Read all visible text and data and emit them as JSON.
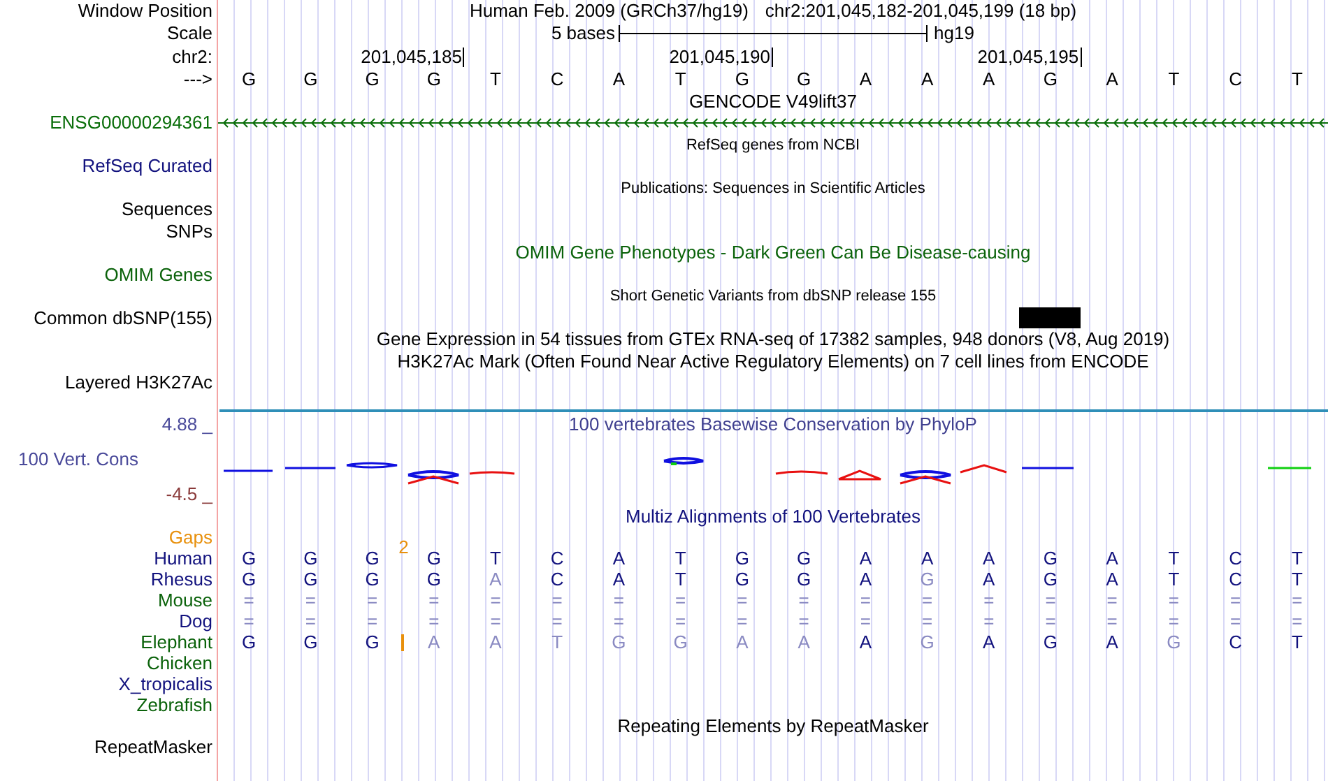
{
  "header": {
    "window_label": "Window Position",
    "assembly": "Human Feb. 2009 (GRCh37/hg19)",
    "position": "chr2:201,045,182-201,045,199 (18 bp)",
    "scale_label": "Scale",
    "scale_text": "5 bases",
    "scale_db": "hg19",
    "chrom_label": "chr2:",
    "ticks": [
      "201,045,185",
      "201,045,190",
      "201,045,195"
    ],
    "strand_label": "--->",
    "bases": [
      "G",
      "G",
      "G",
      "G",
      "T",
      "C",
      "A",
      "T",
      "G",
      "G",
      "A",
      "A",
      "A",
      "G",
      "A",
      "T",
      "C",
      "T"
    ]
  },
  "tracks": [
    {
      "kind": "title",
      "text": "GENCODE V49lift37",
      "color": "#000000"
    },
    {
      "kind": "gene",
      "label": "ENSG00000294361",
      "color": "#0a6e0a"
    },
    {
      "kind": "small_title",
      "text": "RefSeq genes from NCBI",
      "color": "#000000"
    },
    {
      "kind": "label",
      "label": "RefSeq Curated",
      "color": "#12127e"
    },
    {
      "kind": "small_title",
      "text": "Publications: Sequences in Scientific Articles",
      "color": "#000000"
    },
    {
      "kind": "label",
      "label": "Sequences",
      "color": "#000000"
    },
    {
      "kind": "label",
      "label": "SNPs",
      "color": "#000000"
    },
    {
      "kind": "title",
      "text": "OMIM Gene Phenotypes - Dark Green Can Be Disease-causing",
      "color": "#0a620a"
    },
    {
      "kind": "label",
      "label": "OMIM Genes",
      "color": "#0a620a"
    },
    {
      "kind": "small_title",
      "text": "Short Genetic Variants from dbSNP release 155",
      "color": "#000000"
    },
    {
      "kind": "snp",
      "label": "Common dbSNP(155)",
      "color": "#000000"
    },
    {
      "kind": "title",
      "text": "Gene Expression in 54 tissues from GTEx RNA-seq of 17382 samples, 948 donors (V8, Aug 2019)",
      "color": "#000000"
    },
    {
      "kind": "title",
      "text": "H3K27Ac Mark (Often Found Near Active Regulatory Elements) on 7 cell lines from ENCODE",
      "color": "#000000"
    },
    {
      "kind": "label",
      "label": "Layered H3K27Ac",
      "color": "#000000"
    }
  ],
  "conservation": {
    "title": "100 vertebrates Basewise Conservation by PhyloP",
    "label": "100 Vert. Cons",
    "max": "4.88 _",
    "min": "-4.5 _"
  },
  "alignment": {
    "title": "Multiz Alignments of 100 Vertebrates",
    "gaps_label": "Gaps",
    "species": [
      {
        "name": "Human",
        "color": "#12127e",
        "bases": [
          {
            "base": "G",
            "match": true
          },
          {
            "base": "G",
            "match": true
          },
          {
            "base": "G",
            "match": true
          },
          {
            "base": "G",
            "match": true
          },
          {
            "base": "T",
            "match": true
          },
          {
            "base": "C",
            "match": true
          },
          {
            "base": "A",
            "match": true
          },
          {
            "base": "T",
            "match": true
          },
          {
            "base": "G",
            "match": true
          },
          {
            "base": "G",
            "match": true
          },
          {
            "base": "A",
            "match": true
          },
          {
            "base": "A",
            "match": true
          },
          {
            "base": "A",
            "match": true
          },
          {
            "base": "G",
            "match": true
          },
          {
            "base": "A",
            "match": true
          },
          {
            "base": "T",
            "match": true
          },
          {
            "base": "C",
            "match": true
          },
          {
            "base": "T",
            "match": true
          }
        ]
      },
      {
        "name": "Rhesus",
        "color": "#12127e",
        "bases": [
          {
            "base": "G",
            "match": true
          },
          {
            "base": "G",
            "match": true
          },
          {
            "base": "G",
            "match": true
          },
          {
            "base": "G",
            "match": true
          },
          {
            "base": "A",
            "match": false
          },
          {
            "base": "C",
            "match": true
          },
          {
            "base": "A",
            "match": true
          },
          {
            "base": "T",
            "match": true
          },
          {
            "base": "G",
            "match": true
          },
          {
            "base": "G",
            "match": true
          },
          {
            "base": "A",
            "match": true
          },
          {
            "base": "G",
            "match": false
          },
          {
            "base": "A",
            "match": true
          },
          {
            "base": "G",
            "match": true
          },
          {
            "base": "A",
            "match": true
          },
          {
            "base": "T",
            "match": true
          },
          {
            "base": "C",
            "match": true
          },
          {
            "base": "T",
            "match": true
          }
        ]
      },
      {
        "name": "Mouse",
        "color": "#0a620a",
        "bases": [
          {
            "base": "=",
            "match": false
          },
          {
            "base": "=",
            "match": false
          },
          {
            "base": "=",
            "match": false
          },
          {
            "base": "=",
            "match": false
          },
          {
            "base": "=",
            "match": false
          },
          {
            "base": "=",
            "match": false
          },
          {
            "base": "=",
            "match": false
          },
          {
            "base": "=",
            "match": false
          },
          {
            "base": "=",
            "match": false
          },
          {
            "base": "=",
            "match": false
          },
          {
            "base": "=",
            "match": false
          },
          {
            "base": "=",
            "match": false
          },
          {
            "base": "=",
            "match": false
          },
          {
            "base": "=",
            "match": false
          },
          {
            "base": "=",
            "match": false
          },
          {
            "base": "=",
            "match": false
          },
          {
            "base": "=",
            "match": false
          },
          {
            "base": "=",
            "match": false
          }
        ]
      },
      {
        "name": "Dog",
        "color": "#12127e",
        "bases": [
          {
            "base": "=",
            "match": false
          },
          {
            "base": "=",
            "match": false
          },
          {
            "base": "=",
            "match": false
          },
          {
            "base": "=",
            "match": false
          },
          {
            "base": "=",
            "match": false
          },
          {
            "base": "=",
            "match": false
          },
          {
            "base": "=",
            "match": false
          },
          {
            "base": "=",
            "match": false
          },
          {
            "base": "=",
            "match": false
          },
          {
            "base": "=",
            "match": false
          },
          {
            "base": "=",
            "match": false
          },
          {
            "base": "=",
            "match": false
          },
          {
            "base": "=",
            "match": false
          },
          {
            "base": "=",
            "match": false
          },
          {
            "base": "=",
            "match": false
          },
          {
            "base": "=",
            "match": false
          },
          {
            "base": "=",
            "match": false
          },
          {
            "base": "=",
            "match": false
          }
        ]
      },
      {
        "name": "Elephant",
        "color": "#0a620a",
        "bases": [
          {
            "base": "G",
            "match": true
          },
          {
            "base": "G",
            "match": true
          },
          {
            "base": "G",
            "match": true,
            "insertion": "2"
          },
          {
            "base": "A",
            "match": false
          },
          {
            "base": "A",
            "match": false
          },
          {
            "base": "T",
            "match": false
          },
          {
            "base": "G",
            "match": false
          },
          {
            "base": "G",
            "match": false
          },
          {
            "base": "A",
            "match": false
          },
          {
            "base": "A",
            "match": false
          },
          {
            "base": "A",
            "match": true
          },
          {
            "base": "G",
            "match": false
          },
          {
            "base": "A",
            "match": true
          },
          {
            "base": "G",
            "match": true
          },
          {
            "base": "A",
            "match": true
          },
          {
            "base": "G",
            "match": false
          },
          {
            "base": "C",
            "match": true
          },
          {
            "base": "T",
            "match": true
          }
        ]
      },
      {
        "name": "Chicken",
        "color": "#0a620a"
      },
      {
        "name": "X_tropicalis",
        "color": "#12127e"
      },
      {
        "name": "Zebrafish",
        "color": "#0a620a"
      }
    ]
  },
  "repeats": {
    "title": "Repeating Elements by RepeatMasker",
    "label": "RepeatMasker"
  }
}
